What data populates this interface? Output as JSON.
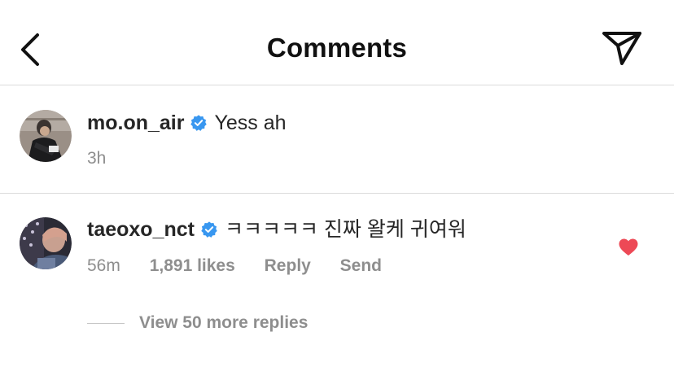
{
  "header": {
    "title": "Comments"
  },
  "comments": [
    {
      "username": "mo.on_air",
      "text": "Yess ah",
      "time": "3h",
      "verified": true
    },
    {
      "username": "taeoxo_nct",
      "text": "ㅋㅋㅋㅋㅋ 진짜 왈케 귀여워",
      "time": "56m",
      "likes": "1,891 likes",
      "reply_label": "Reply",
      "send_label": "Send",
      "verified": true,
      "liked": true,
      "view_replies_label": "View 50 more replies"
    }
  ],
  "colors": {
    "verified_blue": "#3897f0",
    "heart_red": "#ed4956",
    "secondary_text": "#8e8e8e",
    "divider": "#dbdbdb"
  },
  "icons": {
    "back": "chevron-left-icon",
    "send": "paper-plane-icon",
    "verified": "verified-badge-icon",
    "like": "heart-filled-icon"
  }
}
